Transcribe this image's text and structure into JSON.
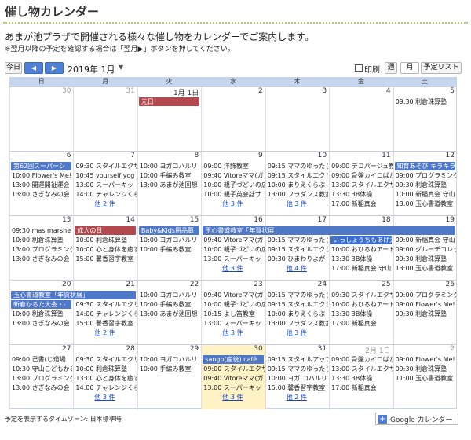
{
  "page": {
    "title": "催し物カレンダー",
    "intro": "あまが池プラザで開催される様々な催し物をカレンダーでご案内します。",
    "note": "※翌月以降の予定を確認する場合は「翌月▶」ボタンを押してください。"
  },
  "toolbar": {
    "today_label": "今日",
    "prev_icon": "triangle-left-icon",
    "next_icon": "triangle-right-icon",
    "month_label": "2019年 1月",
    "print_label": "印刷",
    "view_week": "週",
    "view_month": "月",
    "view_agenda": "予定リスト"
  },
  "weekdays": [
    "日",
    "月",
    "火",
    "水",
    "木",
    "金",
    "土"
  ],
  "weeks": [
    {
      "days": [
        {
          "num": "30",
          "dim": true,
          "events": []
        },
        {
          "num": "31",
          "dim": true,
          "events": []
        },
        {
          "num": "1月 1日",
          "events": []
        },
        {
          "num": "2",
          "events": []
        },
        {
          "num": "3",
          "events": []
        },
        {
          "num": "4",
          "events": []
        },
        {
          "num": "5",
          "events": [
            "09:30 利倉珠算塾"
          ]
        }
      ],
      "bars": [
        {
          "text": "元日",
          "start": 2,
          "span": 1,
          "row": 0,
          "color": "red"
        }
      ]
    },
    {
      "days": [
        {
          "num": "6",
          "events": [
            "",
            "10:00 Flower's Me!",
            "13:00 開運開祉運会",
            "13:00 さぎなみの会"
          ]
        },
        {
          "num": "7",
          "events": [
            "09:30 スタイルエクサ",
            "10:45 yourself yog",
            "13:00 スーパーキッ",
            "14:00 チャレンジくらぶ"
          ],
          "more": "他 2 件"
        },
        {
          "num": "8",
          "events": [
            "10:00 ヨガコハルリ",
            "10:00 手編み教室",
            "13:00 あまが池回想"
          ]
        },
        {
          "num": "9",
          "events": [
            "09:00 洋飾教室",
            "09:40 Vitoreママ(ガ",
            "10:00 親子づどいの広",
            "10:00 親子英会話サ"
          ],
          "more": "他 3 件"
        },
        {
          "num": "10",
          "events": [
            "09:15 ママのゆったり",
            "09:15 スタイルエクサ+",
            "10:00 まりえくらぶ",
            "13:00 フラダンス教室"
          ],
          "more": "他 3 件"
        },
        {
          "num": "11",
          "events": [
            "09:00 デコパージュ教",
            "09:00 骨盤カイロばか",
            "13:00 スタイルエクサ",
            "13:30 3B体操",
            "17:00 新稲真会"
          ]
        },
        {
          "num": "12",
          "events": [
            "",
            "09:00 プログラミング",
            "09:30 利倉珠算塾",
            "10:00 新稲真会 守山",
            "13:00 玉心書道教室"
          ]
        }
      ],
      "bars": [
        {
          "text": "第62回スーパーシ",
          "start": 0,
          "span": 1,
          "row": 0,
          "color": "blue"
        },
        {
          "text": "知育あそび キラキラ",
          "start": 6,
          "span": 1,
          "row": 0,
          "color": "blue"
        }
      ]
    },
    {
      "days": [
        {
          "num": "13",
          "events": [
            "09:30 mas marshe",
            "10:00 利倉珠算塾",
            "13:00 プログラミング",
            "13:00 さぎなみの会"
          ]
        },
        {
          "num": "14",
          "events": [
            "",
            "10:00 利倉珠算塾",
            "10:00 心と身体を癒す",
            "15:00 馨香習字教室"
          ]
        },
        {
          "num": "15",
          "events": [
            "",
            "10:00 ヨガコハルリ",
            "10:00 手編み教室"
          ]
        },
        {
          "num": "16",
          "events": [
            "",
            "09:40 Vitoreママ(ガ",
            "10:00 親子づどいの広",
            "13:00 スーパーキッ"
          ],
          "more": "他 3 件"
        },
        {
          "num": "17",
          "events": [
            "",
            "09:15 ママのゆったり",
            "09:15 スタイルエクサ+",
            "09:30 ひまわりよが"
          ],
          "more": "他 4 件"
        },
        {
          "num": "18",
          "events": [
            "",
            "",
            "10:00 おひるねアート",
            "13:30 3B体操",
            "17:00 新稲真会 守山"
          ]
        },
        {
          "num": "19",
          "events": [
            "",
            "09:00 新稲真会 守山",
            "09:00 グルーデコレッ",
            "09:30 利倉珠算塾",
            "13:00 玉心書道教室"
          ]
        }
      ],
      "bars": [
        {
          "text": "成人の日",
          "start": 1,
          "span": 1,
          "row": 0,
          "color": "red"
        },
        {
          "text": "Baby&Kids用品募",
          "start": 2,
          "span": 1,
          "row": 0,
          "color": "blue"
        },
        {
          "text": "玉心書道教室「年賀状展」",
          "start": 3,
          "span": 4,
          "row": 0,
          "color": "blue"
        },
        {
          "text": "いっしょうちもあげ大",
          "start": 5,
          "span": 1,
          "row": 1,
          "color": "bluelight"
        }
      ]
    },
    {
      "days": [
        {
          "num": "20",
          "events": [
            "",
            "",
            "10:00 利倉珠算塾",
            "13:00 さぎなみの会"
          ]
        },
        {
          "num": "21",
          "events": [
            "",
            "09:30 スタイルエクサ",
            "14:00 チャレンジくらぶ",
            "15:00 馨香習字教室"
          ],
          "more": "他 2 件"
        },
        {
          "num": "22",
          "events": [
            "10:00 ヨガコハルリ",
            "10:00 手編み教室",
            "13:00 あまが池回想"
          ]
        },
        {
          "num": "23",
          "events": [
            "09:40 Vitoreママ(ガ",
            "10:00 親子づどいの広",
            "10:15 よし笛教室",
            "13:00 スーパーキッ"
          ],
          "more": "他 3 件"
        },
        {
          "num": "24",
          "events": [
            "09:15 ママのゆったり",
            "09:15 スタイルエクサ+",
            "10:00 まりえくらぶ",
            "13:00 フラダンス教室"
          ],
          "more": "他 3 件"
        },
        {
          "num": "25",
          "events": [
            "09:30 スタイルエクサ",
            "10:00 おひるねアート",
            "13:30 3B体操",
            "17:00 新稲真会"
          ]
        },
        {
          "num": "26",
          "events": [
            "09:00 プログラミング",
            "09:00 Flower's Me!",
            "09:30 利倉珠算塾"
          ]
        }
      ],
      "bars": [
        {
          "text": "玉心書道教室「年賀状展」",
          "start": 0,
          "span": 2,
          "row": 0,
          "color": "blue"
        },
        {
          "text": "新春かるた大会・-",
          "start": 0,
          "span": 1,
          "row": 1,
          "color": "blue"
        }
      ]
    },
    {
      "days": [
        {
          "num": "27",
          "events": [
            "09:00 己書(じ道場",
            "10:30 守山こどもかる",
            "13:00 プログラミング",
            "13:00 さぎなみの会"
          ]
        },
        {
          "num": "28",
          "events": [
            "09:30 スタイルエクサ",
            "10:00 利倉珠算塾",
            "13:00 心と身体を癒す",
            "14:00 チャレンジくらぶ"
          ],
          "more": "他 3 件"
        },
        {
          "num": "29",
          "events": [
            "10:00 ヨガコハルリ",
            "10:00 手編み教室"
          ]
        },
        {
          "num": "30",
          "today": true,
          "events": [
            "",
            "09:00 スタイルエクサ+",
            "09:40 Vitoreママ(ガ",
            "13:00 スーパーキッ"
          ],
          "more": "他 3 件"
        },
        {
          "num": "31",
          "events": [
            "09:15 スタイルアップ+",
            "09:15 ママのゆったり",
            "10:00 ヨガ コハルリ",
            "15:00 馨香習字教室"
          ],
          "more": "他 2 件"
        },
        {
          "num": "2月 1日",
          "dim": true,
          "events": [
            "09:00 骨盤カイロばか",
            "13:00 スタイルエクサ",
            "13:30 3B体操",
            "17:00 新稲真会"
          ]
        },
        {
          "num": "2",
          "dim": true,
          "events": [
            "09:00 Flower's Me!",
            "09:30 利倉珠算塾",
            "11:00 玉心書道教室"
          ]
        }
      ],
      "bars": [
        {
          "text": "sango(産後) café",
          "start": 3,
          "span": 1,
          "row": 0,
          "color": "blue"
        }
      ]
    }
  ],
  "footer": {
    "timezone": "予定を表示するタイムゾーン: 日本標準時",
    "gcal_label": "Google カレンダー"
  }
}
